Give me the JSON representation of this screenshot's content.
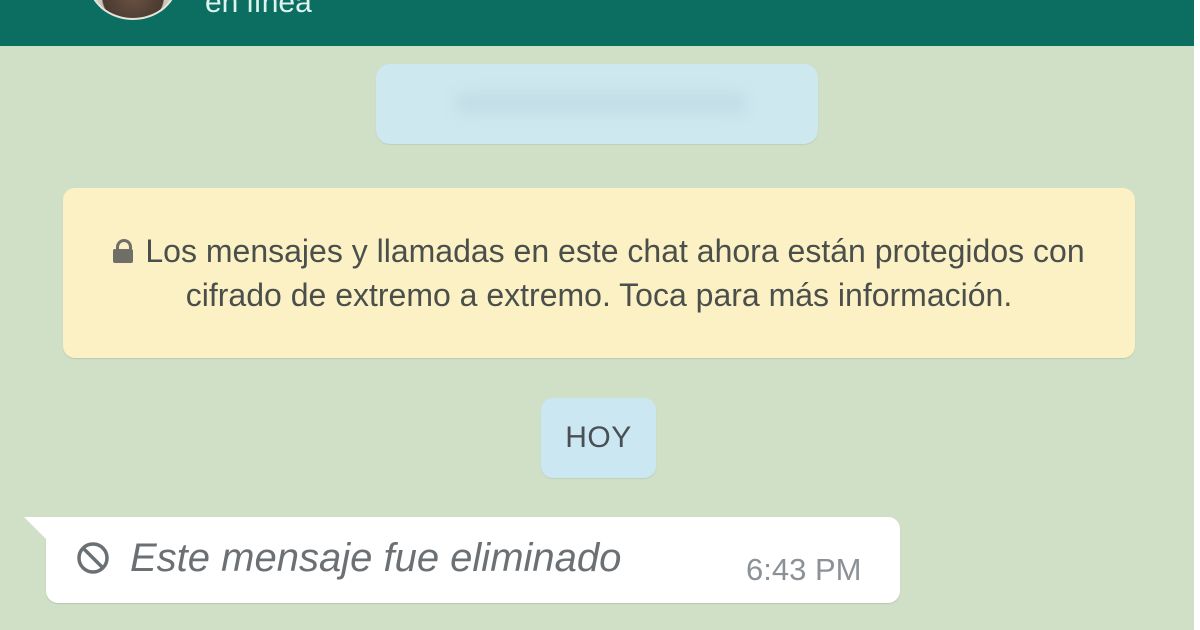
{
  "header": {
    "status": "en línea"
  },
  "chat": {
    "encryption_notice": "Los mensajes y llamadas en este chat ahora están protegidos con cifrado de extremo a extremo. Toca para más información.",
    "date_label": "HOY",
    "messages": [
      {
        "text": "Este mensaje fue eliminado",
        "time": "6:43 PM",
        "icon": "blocked-icon"
      }
    ]
  },
  "colors": {
    "header_background": "#0b6e60",
    "chat_background": "#cfe0c6",
    "notice_background": "#fbf1c4",
    "date_chip_background": "#cbe7f1",
    "message_background": "#ffffff"
  }
}
